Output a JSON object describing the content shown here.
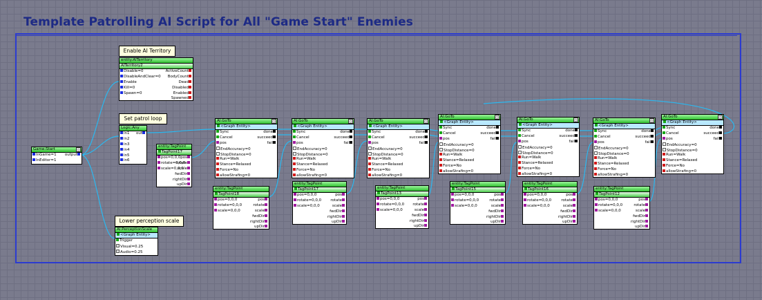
{
  "title": "Template Patrolling AI Script for All \"Game Start\" Enemies",
  "comments": {
    "enable": "Enable AI Territory",
    "patrol": "Set patrol loop",
    "perception": "Lower perception scale"
  },
  "game_start": {
    "header": "Game:Start",
    "in_game": "InGame=1",
    "in_editor": "InEditor=1",
    "output": "output"
  },
  "territory": {
    "header": "entity:AITerritory",
    "entity": "AITerritory2",
    "inputs": [
      "Disable=0",
      "DisableAndClear=0",
      "Enable",
      "Kill=0",
      "Spawn=0"
    ],
    "outputs": [
      "ActiveCount",
      "BodyCount",
      "Dead",
      "Disabled",
      "Enabled",
      "Spawned"
    ]
  },
  "logic_any": {
    "header": "Logic:Any",
    "inputs": [
      "in1",
      "in2",
      "in3",
      "in4",
      "in5",
      "in6"
    ],
    "output": "out"
  },
  "perception": {
    "header": "AI:PerceptionScale",
    "entity": "<Graph Entity>",
    "rows": [
      "Trigger",
      "Visual=0.25",
      "Audio=0.25"
    ]
  },
  "goto_labels": {
    "header": "AI:GoTo",
    "entity": "<Graph Entity>",
    "inputs": [
      "Sync",
      "Cancel",
      "pos",
      "EndAccuracy=0",
      "StopDistance=0",
      "Run=Walk",
      "Stance=Relaxed",
      "Force=No",
      "allowStrafing=0"
    ],
    "outputs": [
      "done",
      "succeed",
      "fail"
    ]
  },
  "tagpoint_labels": {
    "header": "entity:TagPoint",
    "inputs": [
      "pos=0,0,0",
      "rotate=0,0,0",
      "scale=0,0,0"
    ],
    "outputs": [
      "pos",
      "rotate",
      "scale",
      "fwdDir",
      "rightDir",
      "upDir"
    ]
  },
  "tagpoints": [
    "TagPoint17",
    "TagPoint18",
    "TagPoint17",
    "TagPoint13",
    "TagPoint15",
    "TagPoint16",
    "TagPoint12"
  ]
}
